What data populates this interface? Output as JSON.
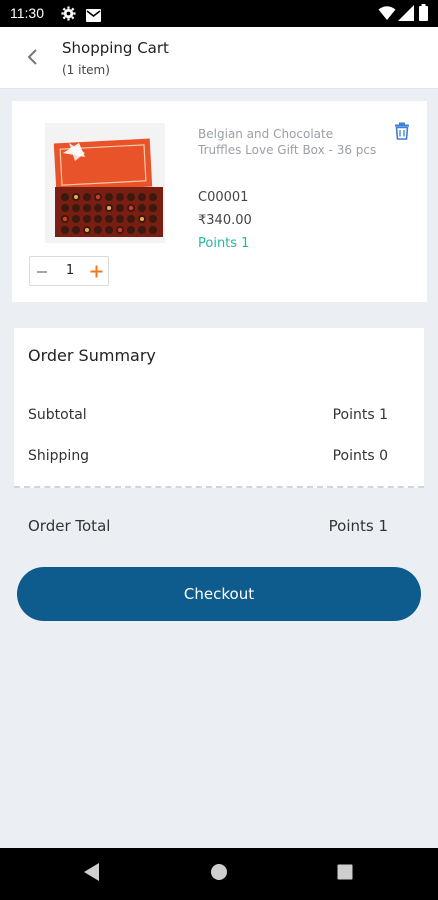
{
  "status_bar": {
    "time": "11:30",
    "icons": [
      "gear-icon",
      "mail-icon",
      "wifi-icon",
      "signal-icon",
      "battery-icon"
    ]
  },
  "header": {
    "title": "Shopping Cart",
    "subtitle": "(1 item)",
    "back_icon": "chevron-left-icon"
  },
  "cart": {
    "items": [
      {
        "name": "Belgian and Chocolate Truffles Love Gift Box - 36 pcs",
        "code": "C00001",
        "price": "₹340.00",
        "points": "Points 1",
        "quantity": "1",
        "delete_icon": "trash-icon"
      }
    ]
  },
  "summary": {
    "title": "Order Summary",
    "subtotal_label": "Subtotal",
    "subtotal_value": "Points 1",
    "shipping_label": "Shipping",
    "shipping_value": "Points 0",
    "total_label": "Order Total",
    "total_value": "Points 1"
  },
  "checkout": {
    "label": "Checkout"
  },
  "colors": {
    "accent": "#0e5b8e",
    "points": "#21b8a2",
    "qty_plus": "#f07a1a",
    "delete": "#3b7fd6",
    "background": "#ebeff4"
  },
  "nav": {
    "icons": [
      "back-triangle-icon",
      "home-circle-icon",
      "recents-square-icon"
    ]
  }
}
